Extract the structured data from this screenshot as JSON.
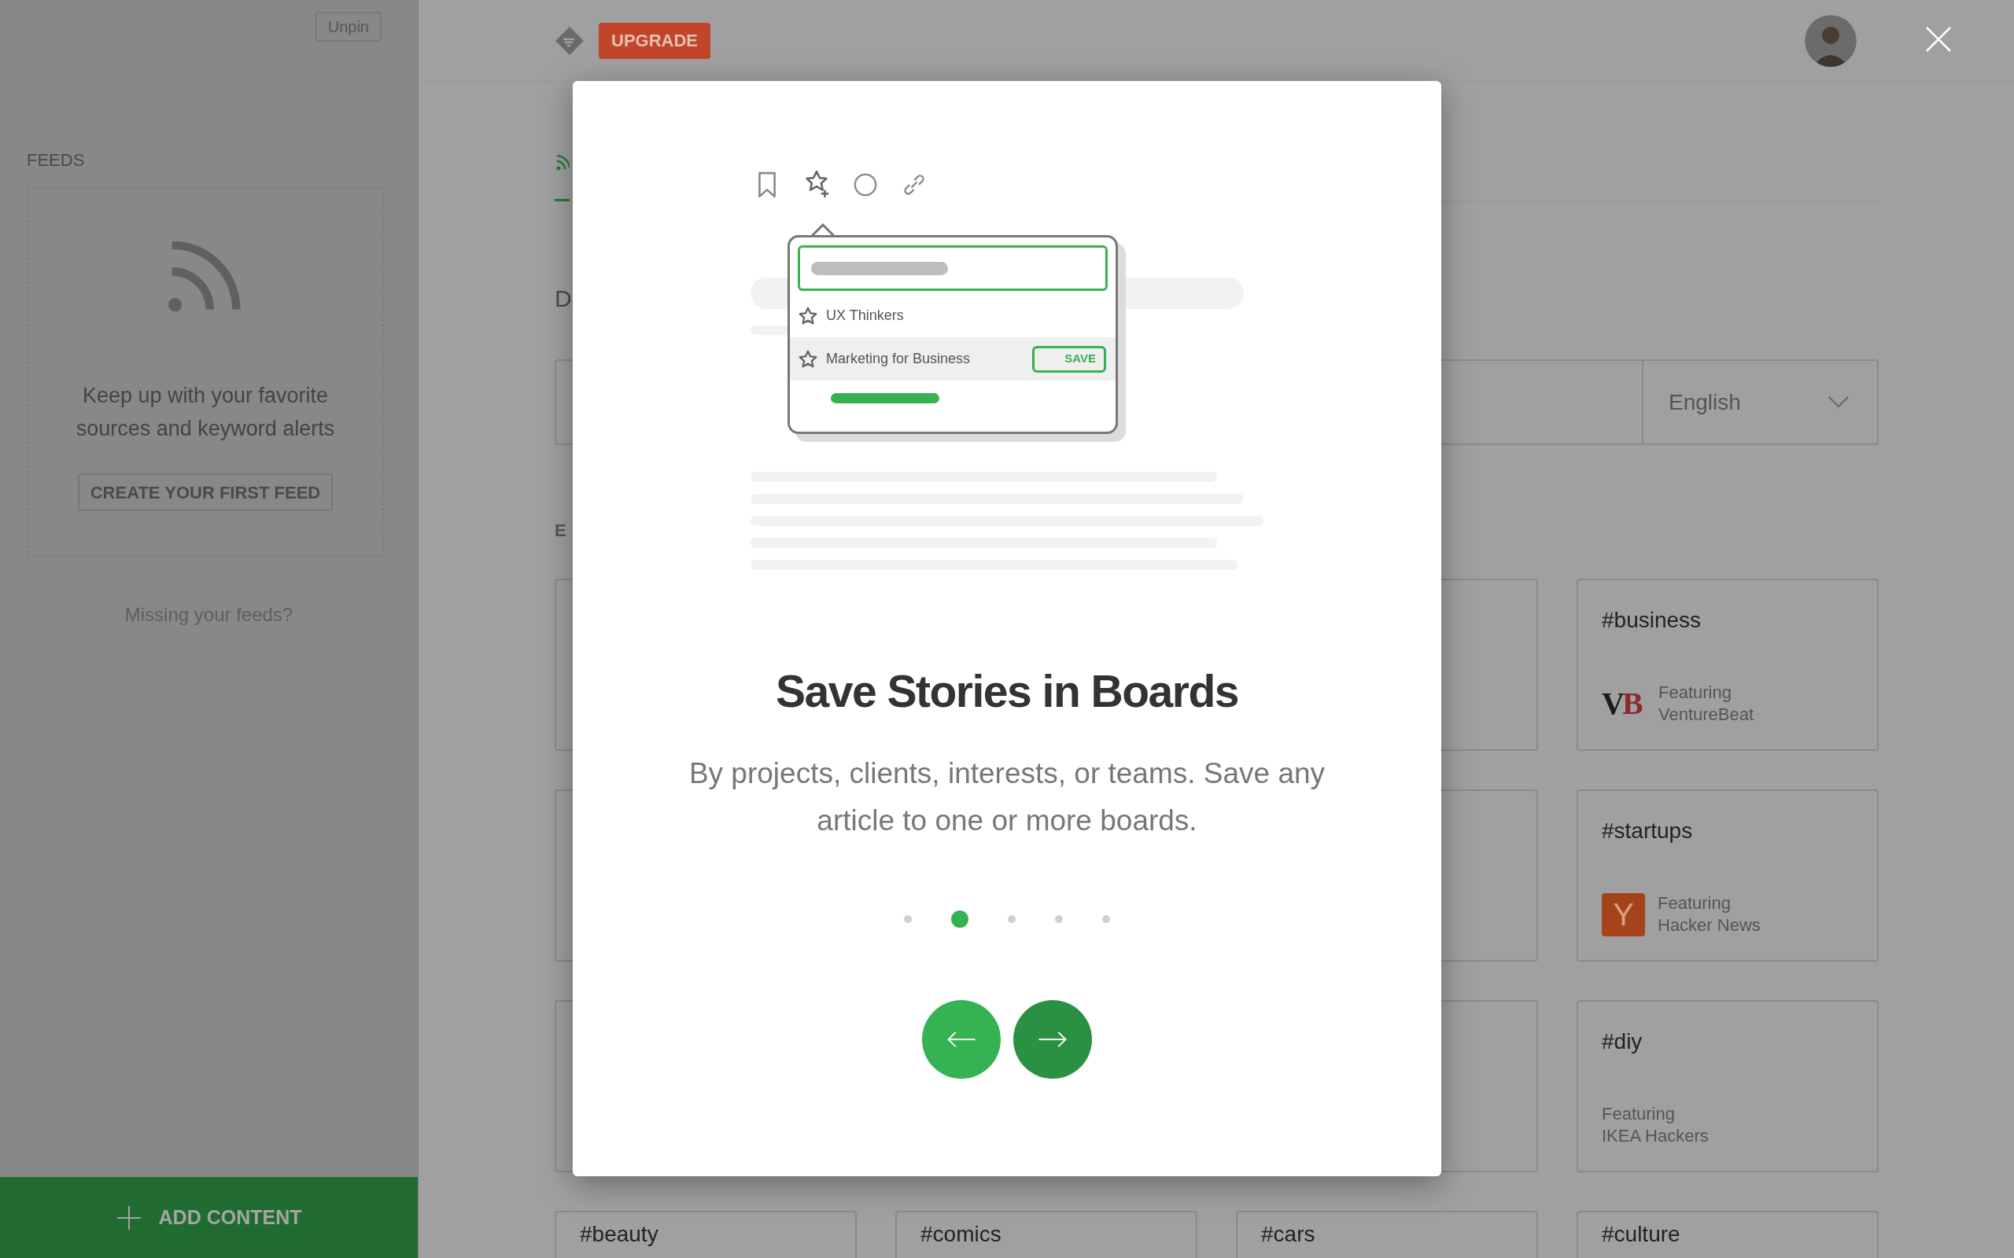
{
  "sidebar": {
    "unpin_button": "Unpin",
    "section_title": "FEEDS",
    "empty_state": {
      "message_lines": [
        "Keep up with your favorite",
        "sources and keyword alerts"
      ],
      "button": "CREATE YOUR FIRST FEED"
    },
    "missing_link": "Missing your feeds?",
    "add_button": "ADD CONTENT"
  },
  "header": {
    "upgrade_button": "UPGRADE"
  },
  "main": {
    "heading": "D",
    "language_select": "English",
    "section_label": "E",
    "featured_cards": [
      {
        "title": "#business",
        "featuring": "Featuring",
        "source": "VentureBeat",
        "logo": {
          "kind": "split",
          "first": "V",
          "second": "B"
        }
      },
      {
        "title": "#startups",
        "featuring": "Featuring",
        "source": "Hacker News",
        "logo": {
          "kind": "tile",
          "text": "Y"
        }
      },
      {
        "title": "#diy",
        "featuring": "Featuring",
        "source": "IKEA Hackers",
        "logo": {
          "kind": "none"
        }
      }
    ],
    "bottom_cards": [
      {
        "title": "#beauty"
      },
      {
        "title": "#comics"
      },
      {
        "title": "#cars"
      },
      {
        "title": "#culture"
      }
    ]
  },
  "modal": {
    "boards": [
      {
        "name": "UX Thinkers",
        "highlighted": false
      },
      {
        "name": "Marketing for Business",
        "highlighted": true,
        "action": "SAVE"
      }
    ],
    "title": "Save Stories in Boards",
    "description": "By projects, clients, interests, or teams. Save any article to one or more boards.",
    "dots": [
      {
        "selected": false
      },
      {
        "selected": true
      },
      {
        "selected": false
      },
      {
        "selected": false
      },
      {
        "selected": false
      }
    ]
  }
}
